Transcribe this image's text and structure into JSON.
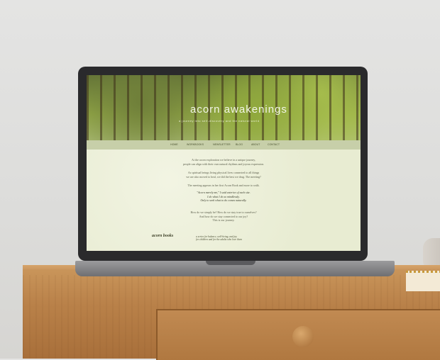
{
  "site": {
    "title": "acorn  awakenings",
    "subtitle": "a journey into self-discovery and the natural world"
  },
  "nav": [
    "HOME",
    "WORKBOOKS",
    "NEWSLETTER",
    "BLOG",
    "ABOUT",
    "CONTACT"
  ],
  "content": {
    "lines": [
      "At the acorn exploration we believe in a unique journey,",
      "people can align with their own natural rhythms and joyous expression.",
      "As spiritual beings living physical lives connected to all things",
      "we are also moved to heal, we did the best we drug. The meeting?",
      "The meeting appears in her first Acorn Book and more to walk."
    ],
    "quote": [
      "\"Acorn merely me,\" I said exterior of each site.",
      "I do what I do so mindlessly.",
      "Only to seek what to do comes naturally."
    ],
    "closing": [
      "How do we simply be? How do we stay true to ourselves?",
      "And how do we stay connected to our joy?",
      "This is our journey."
    ]
  },
  "books": {
    "label": "acorn books",
    "description": [
      "a series for balance, well-being, and joy",
      "for children and for the adults who love them"
    ]
  }
}
